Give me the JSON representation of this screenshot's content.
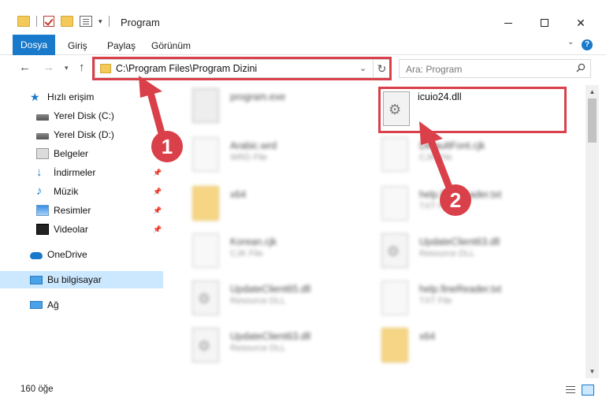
{
  "window": {
    "title": "Program"
  },
  "ribbon": {
    "tabs": [
      "Dosya",
      "Giriş",
      "Paylaş",
      "Görünüm"
    ]
  },
  "address": {
    "path": "C:\\Program Files\\Program Dizini"
  },
  "search": {
    "placeholder": "Ara: Program"
  },
  "sidebar": {
    "items": [
      {
        "label": "Hızlı erişim",
        "icon": "star-icon"
      },
      {
        "label": "Yerel Disk (C:)",
        "icon": "drive-icon"
      },
      {
        "label": "Yerel Disk (D:)",
        "icon": "drive-icon"
      },
      {
        "label": "Belgeler",
        "icon": "documents-icon"
      },
      {
        "label": "İndirmeler",
        "icon": "download-icon"
      },
      {
        "label": "Müzik",
        "icon": "music-icon"
      },
      {
        "label": "Resimler",
        "icon": "pictures-icon"
      },
      {
        "label": "Videolar",
        "icon": "video-icon"
      },
      {
        "label": "OneDrive",
        "icon": "cloud-icon"
      },
      {
        "label": "Bu bilgisayar",
        "icon": "computer-icon"
      },
      {
        "label": "Ağ",
        "icon": "network-icon"
      }
    ]
  },
  "files": [
    {
      "name": "program.exe",
      "type": "",
      "icon": "exe-icon",
      "blurred": true
    },
    {
      "name": "icuio24.dll",
      "type": "",
      "icon": "dll-icon",
      "blurred": false
    },
    {
      "name": "Arabic.wrd",
      "type": "WRD File",
      "icon": "document-icon",
      "blurred": true
    },
    {
      "name": "DefaultFont.cjk",
      "type": "CJK File",
      "icon": "document-icon",
      "blurred": true
    },
    {
      "name": "x64",
      "type": "",
      "icon": "folder-icon",
      "blurred": true
    },
    {
      "name": "help.fineReader.txt",
      "type": "TXT File",
      "icon": "document-icon",
      "blurred": true
    },
    {
      "name": "Korean.cjk",
      "type": "CJK File",
      "icon": "document-icon",
      "blurred": true
    },
    {
      "name": "UpdateClient63.dll",
      "type": "Resource DLL",
      "icon": "dll-icon",
      "blurred": true
    },
    {
      "name": "UpdateClient65.dll",
      "type": "Resource DLL",
      "icon": "dll-icon",
      "blurred": true
    },
    {
      "name": "help.fineReader.txt",
      "type": "TXT File",
      "icon": "document-icon",
      "blurred": true
    },
    {
      "name": "UpdateClient63.dll",
      "type": "Resource DLL",
      "icon": "dll-icon",
      "blurred": true
    },
    {
      "name": "x64",
      "type": "",
      "icon": "folder-icon",
      "blurred": true
    }
  ],
  "status": {
    "count": "160 öğe"
  },
  "annotations": {
    "step1": "1",
    "step2": "2",
    "highlight_color": "#d9404a"
  }
}
